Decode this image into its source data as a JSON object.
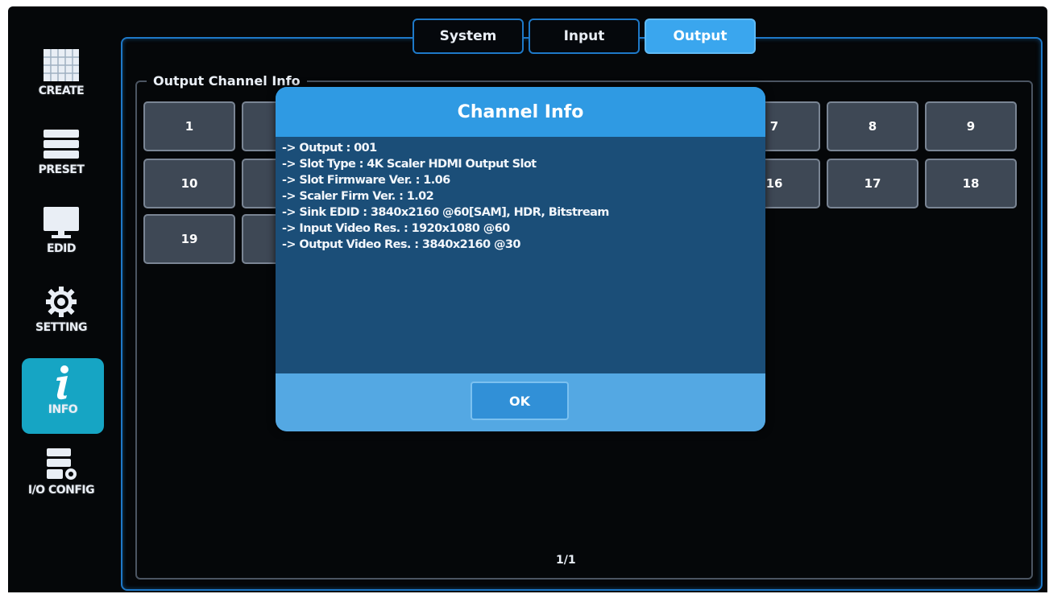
{
  "sidebar": {
    "items": [
      {
        "label": "CREATE",
        "icon": "grid-icon"
      },
      {
        "label": "PRESET",
        "icon": "list-icon"
      },
      {
        "label": "EDID",
        "icon": "monitor-icon"
      },
      {
        "label": "SETTING",
        "icon": "gear-icon"
      },
      {
        "label": "INFO",
        "icon": "info-icon",
        "active": true
      },
      {
        "label": "I/O CONFIG",
        "icon": "io-config-icon"
      }
    ]
  },
  "tabs": [
    {
      "label": "System"
    },
    {
      "label": "Input"
    },
    {
      "label": "Output",
      "active": true
    }
  ],
  "main": {
    "group_title": "Output Channel Info",
    "channels": [
      "1",
      "7",
      "8",
      "9",
      "10",
      "16",
      "17",
      "18",
      "19"
    ],
    "pager": "1/1"
  },
  "dialog": {
    "title": "Channel Info",
    "lines": [
      "-> Output : 001",
      "-> Slot Type : 4K Scaler HDMI Output Slot",
      "-> Slot Firmware Ver. : 1.06",
      "-> Scaler Firm Ver. : 1.02",
      "-> Sink EDID : 3840x2160 @60[SAM], HDR, Bitstream",
      "-> Input Video Res. : 1920x1080 @60",
      "-> Output Video Res. : 3840x2160 @30"
    ],
    "ok_label": "OK"
  },
  "colors": {
    "accent": "#1e79c8",
    "active_tab": "#3aa6ee",
    "active_side": "#16a5c4",
    "dialog_header": "#2f9ae3",
    "dialog_body": "#1b4e78"
  }
}
